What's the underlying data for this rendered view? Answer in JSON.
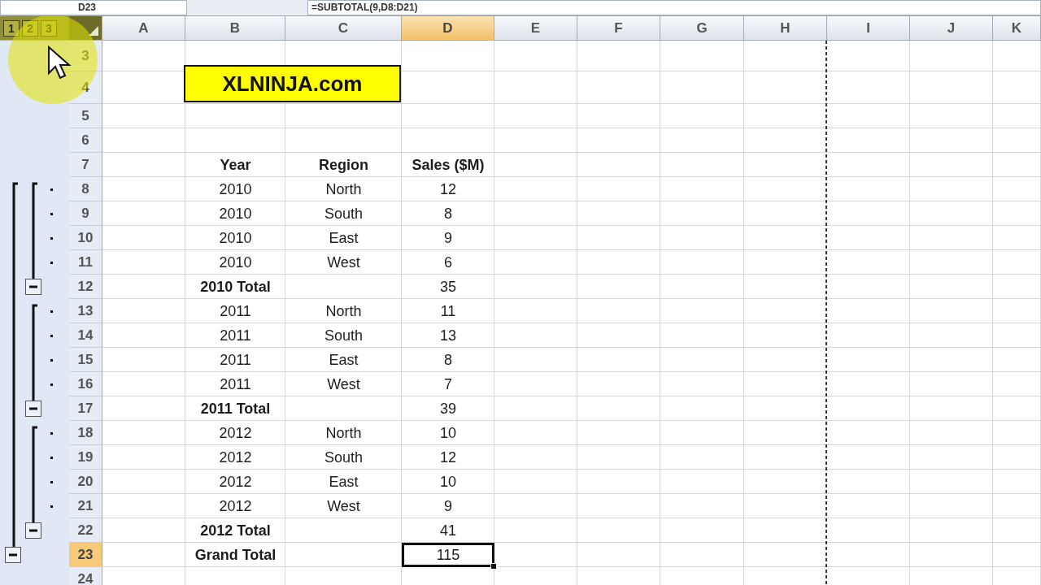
{
  "formula_bar": {
    "name_box": "D23",
    "formula": "=SUBTOTAL(9,D8:D21)"
  },
  "outline_levels": [
    "1",
    "2",
    "3"
  ],
  "columns": [
    {
      "label": "A",
      "selected": false
    },
    {
      "label": "B",
      "selected": false
    },
    {
      "label": "C",
      "selected": false
    },
    {
      "label": "D",
      "selected": true
    },
    {
      "label": "E",
      "selected": false
    },
    {
      "label": "F",
      "selected": false
    },
    {
      "label": "G",
      "selected": false
    },
    {
      "label": "H",
      "selected": false
    },
    {
      "label": "I",
      "selected": false
    },
    {
      "label": "J",
      "selected": false
    },
    {
      "label": "K",
      "selected": false
    }
  ],
  "rows": [
    {
      "number": "3",
      "kind": "blank",
      "selected": false
    },
    {
      "number": "4",
      "kind": "title",
      "banner": "XLNINJA.com",
      "selected": false
    },
    {
      "number": "5",
      "kind": "blank",
      "selected": false
    },
    {
      "number": "6",
      "kind": "blank",
      "selected": false
    },
    {
      "number": "7",
      "kind": "header",
      "cells": [
        "Year",
        "Region",
        "Sales ($M)"
      ],
      "selected": false
    },
    {
      "number": "8",
      "kind": "detail",
      "cells": [
        "2010",
        "North",
        "12"
      ],
      "selected": false
    },
    {
      "number": "9",
      "kind": "detail",
      "cells": [
        "2010",
        "South",
        "8"
      ],
      "selected": false
    },
    {
      "number": "10",
      "kind": "detail",
      "cells": [
        "2010",
        "East",
        "9"
      ],
      "selected": false
    },
    {
      "number": "11",
      "kind": "detail",
      "cells": [
        "2010",
        "West",
        "6"
      ],
      "selected": false
    },
    {
      "number": "12",
      "kind": "subtotal",
      "label": "2010 Total",
      "value": "35",
      "expanded": true,
      "selected": false
    },
    {
      "number": "13",
      "kind": "detail",
      "cells": [
        "2011",
        "North",
        "11"
      ],
      "selected": false
    },
    {
      "number": "14",
      "kind": "detail",
      "cells": [
        "2011",
        "South",
        "13"
      ],
      "selected": false
    },
    {
      "number": "15",
      "kind": "detail",
      "cells": [
        "2011",
        "East",
        "8"
      ],
      "selected": false
    },
    {
      "number": "16",
      "kind": "detail",
      "cells": [
        "2011",
        "West",
        "7"
      ],
      "selected": false
    },
    {
      "number": "17",
      "kind": "subtotal",
      "label": "2011 Total",
      "value": "39",
      "expanded": true,
      "selected": false
    },
    {
      "number": "18",
      "kind": "detail",
      "cells": [
        "2012",
        "North",
        "10"
      ],
      "selected": false
    },
    {
      "number": "19",
      "kind": "detail",
      "cells": [
        "2012",
        "South",
        "12"
      ],
      "selected": false
    },
    {
      "number": "20",
      "kind": "detail",
      "cells": [
        "2012",
        "East",
        "10"
      ],
      "selected": false
    },
    {
      "number": "21",
      "kind": "detail",
      "cells": [
        "2012",
        "West",
        "9"
      ],
      "selected": false
    },
    {
      "number": "22",
      "kind": "subtotal",
      "label": "2012 Total",
      "value": "41",
      "expanded": true,
      "selected": false
    },
    {
      "number": "23",
      "kind": "grand_total",
      "label": "Grand Total",
      "value": "115",
      "expanded": true,
      "selected": true
    },
    {
      "number": "24",
      "kind": "blank",
      "selected": false
    }
  ]
}
